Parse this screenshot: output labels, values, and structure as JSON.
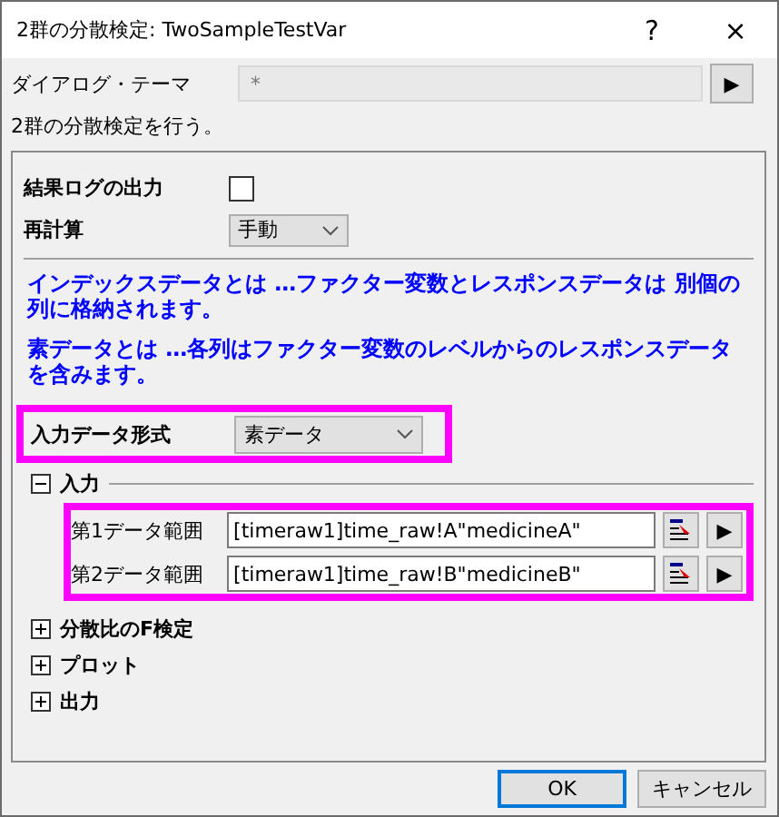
{
  "window": {
    "title": "2群の分散検定: TwoSampleTestVar",
    "help": "?",
    "close": "×"
  },
  "theme": {
    "label": "ダイアログ・テーマ",
    "value": "*",
    "button": "▶"
  },
  "description": "2群の分散検定を行う。",
  "options": [
    {
      "kind": "checkbox",
      "label": "結果ログの出力",
      "checked": false
    },
    {
      "kind": "dropdown",
      "label": "再計算",
      "value": "手動"
    }
  ],
  "notes": [
    "インデックスデータとは …ファクター変数とレスポンスデータは 別個の列に格納されます。",
    "素データとは …各列はファクター変数のレベルからのレスポンスデータを含みます。"
  ],
  "input_format": {
    "label": "入力データ形式",
    "value": "素データ",
    "highlighted": true
  },
  "sections": [
    {
      "label": "入力",
      "expanded": true,
      "highlighted": true,
      "fields": [
        {
          "label": "第1データ範囲",
          "value": "[timeraw1]time_raw!A\"medicineA\"",
          "button": "▶"
        },
        {
          "label": "第2データ範囲",
          "value": "[timeraw1]time_raw!B\"medicineB\"",
          "button": "▶"
        }
      ]
    },
    {
      "label": "分散比のF検定",
      "expanded": false
    },
    {
      "label": "プロット",
      "expanded": false
    },
    {
      "label": "出力",
      "expanded": false
    }
  ],
  "buttons": [
    {
      "label": "OK",
      "selected": true
    },
    {
      "label": "キャンセル",
      "selected": false
    }
  ]
}
